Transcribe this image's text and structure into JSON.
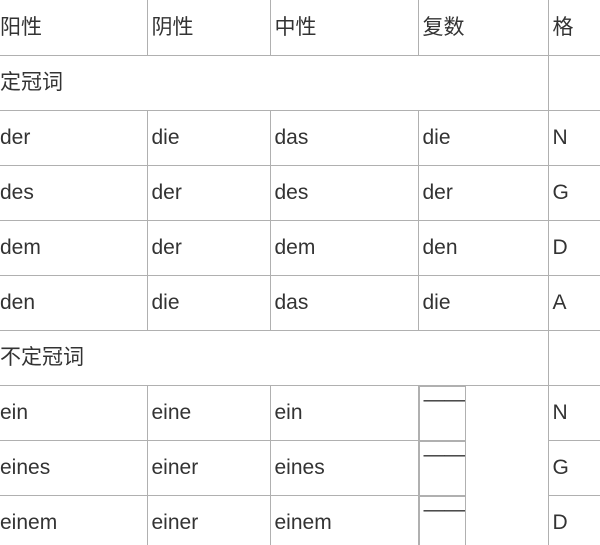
{
  "table": {
    "columns": [
      {
        "key": "masculine",
        "label": "阳性"
      },
      {
        "key": "feminine",
        "label": "阴性"
      },
      {
        "key": "neuter",
        "label": "中性"
      },
      {
        "key": "plural",
        "label": "复数"
      },
      {
        "key": "case",
        "label": "格"
      }
    ],
    "sections": [
      {
        "title": "定冠词",
        "rows": [
          {
            "masculine": "der",
            "feminine": "die",
            "neuter": "das",
            "plural": "die",
            "case": "N"
          },
          {
            "masculine": "des",
            "feminine": "der",
            "neuter": "des",
            "plural": "der",
            "case": "G"
          },
          {
            "masculine": "dem",
            "feminine": "der",
            "neuter": "dem",
            "plural": "den",
            "case": "D"
          },
          {
            "masculine": "den",
            "feminine": "die",
            "neuter": "das",
            "plural": "die",
            "case": "A"
          }
        ]
      },
      {
        "title": "不定冠词",
        "rows": [
          {
            "masculine": "ein",
            "feminine": "eine",
            "neuter": "ein",
            "plural": "——",
            "case": "N"
          },
          {
            "masculine": "eines",
            "feminine": "einer",
            "neuter": "eines",
            "plural": "——",
            "case": "G"
          },
          {
            "masculine": "einem",
            "feminine": "einer",
            "neuter": "einem",
            "plural": "——",
            "case": "D"
          }
        ]
      }
    ]
  },
  "colors": {
    "text": "#333333",
    "border": "#b0b0b0",
    "background": "#ffffff"
  }
}
